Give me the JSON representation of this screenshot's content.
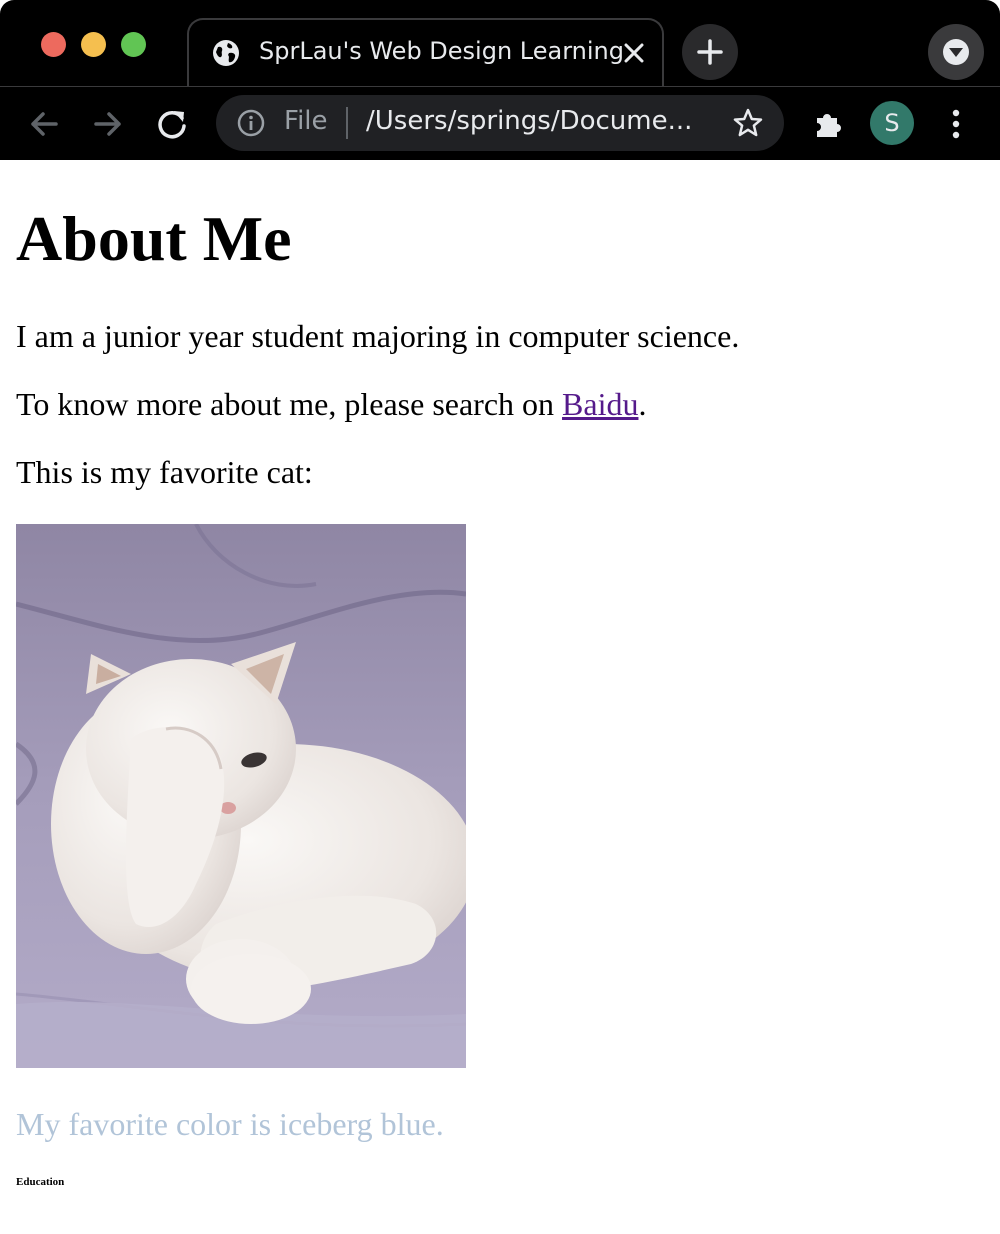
{
  "browser": {
    "tab_title": "SprLau's Web Design Learning",
    "address_scheme_label": "File",
    "address_url": "/Users/springs/Docume...",
    "profile_initial": "S",
    "colors": {
      "chrome_background": "#000000",
      "omnibox_background": "#202124",
      "avatar": "#32796a",
      "traffic_red": "#ed6a5e",
      "traffic_yellow": "#f5bf4f",
      "traffic_green": "#61c554"
    },
    "icons": [
      "globe-icon",
      "close-icon",
      "plus-icon",
      "chevron-down-icon",
      "back-arrow-icon",
      "forward-arrow-icon",
      "reload-icon",
      "info-icon",
      "star-icon",
      "puzzle-icon",
      "more-vertical-icon"
    ]
  },
  "page": {
    "heading": "About Me",
    "intro": "I am a junior year student majoring in computer science.",
    "search_prefix": "To know more about me, please search on ",
    "search_link": "Baidu",
    "search_suffix": ".",
    "cat_caption": "This is my favorite cat:",
    "favorite_color_text": "My favorite color is iceberg blue.",
    "education_heading": "Education",
    "colors": {
      "link": "#551a8b",
      "favorite_color": "#b1c4d8"
    }
  }
}
